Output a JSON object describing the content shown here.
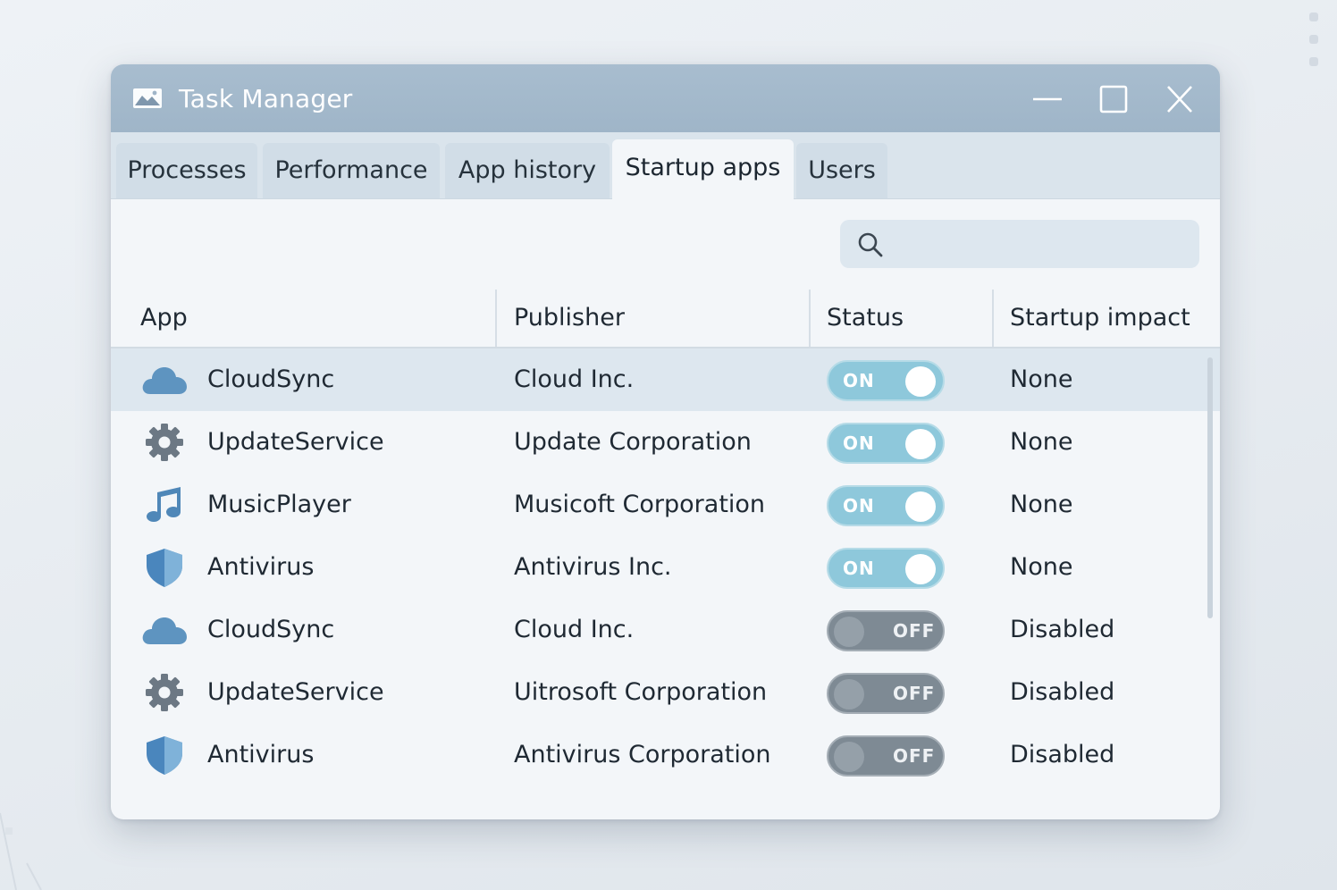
{
  "window": {
    "title": "Task Manager"
  },
  "tabs": [
    {
      "label": "Processes",
      "active": false
    },
    {
      "label": "Performance",
      "active": false
    },
    {
      "label": "App history",
      "active": false
    },
    {
      "label": "Startup apps",
      "active": true
    },
    {
      "label": "Users",
      "active": false
    }
  ],
  "search": {
    "placeholder": "",
    "value": ""
  },
  "columns": {
    "app": "App",
    "publisher": "Publisher",
    "status": "Status",
    "impact": "Startup impact"
  },
  "rows": [
    {
      "icon": "cloud-icon",
      "app": "CloudSync",
      "publisher": "Cloud Inc.",
      "status": "ON",
      "impact": "None",
      "selected": true
    },
    {
      "icon": "gear-icon",
      "app": "UpdateService",
      "publisher": "Update Corporation",
      "status": "ON",
      "impact": "None",
      "selected": false
    },
    {
      "icon": "music-note-icon",
      "app": "MusicPlayer",
      "publisher": "Musicoft Corporation",
      "status": "ON",
      "impact": "None",
      "selected": false
    },
    {
      "icon": "shield-icon",
      "app": "Antivirus",
      "publisher": "Antivirus Inc.",
      "status": "ON",
      "impact": "None",
      "selected": false
    },
    {
      "icon": "cloud-icon",
      "app": "CloudSync",
      "publisher": "Cloud Inc.",
      "status": "OFF",
      "impact": "Disabled",
      "selected": false
    },
    {
      "icon": "gear-icon",
      "app": "UpdateService",
      "publisher": "Uitrosoft Corporation",
      "status": "OFF",
      "impact": "Disabled",
      "selected": false
    },
    {
      "icon": "shield-icon",
      "app": "Antivirus",
      "publisher": "Antivirus Corporation",
      "status": "OFF",
      "impact": "Disabled",
      "selected": false
    }
  ],
  "colors": {
    "titlebar": "#a3b9cc",
    "toggle_on": "#8ec8db",
    "toggle_off": "#7e8a94",
    "selected_row": "#dde7ef"
  }
}
